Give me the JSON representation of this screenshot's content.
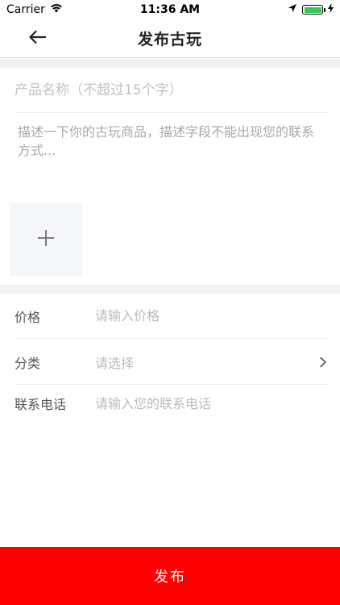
{
  "status_bar": {
    "carrier": "Carrier",
    "time": "11:36 AM",
    "wifi_icon": "wifi-icon",
    "location_icon": "location-arrow-icon",
    "battery_icon": "battery-icon",
    "battery_color": "#34c759"
  },
  "nav": {
    "title": "发布古玩",
    "back_icon": "arrow-left-icon"
  },
  "form": {
    "name_placeholder": "产品名称（不超过15个字）",
    "description_placeholder": "描述一下你的古玩商品，描述字段不能出现您的联系方式...",
    "upload_icon": "plus-icon"
  },
  "details": {
    "price_label": "价格",
    "price_placeholder": "请输入价格",
    "category_label": "分类",
    "category_value": "请选择",
    "category_icon": "chevron-right-icon",
    "phone_label": "联系电话",
    "phone_placeholder": "请输入您的联系电话"
  },
  "footer": {
    "publish_label": "发布",
    "publish_color": "#ff0000"
  }
}
